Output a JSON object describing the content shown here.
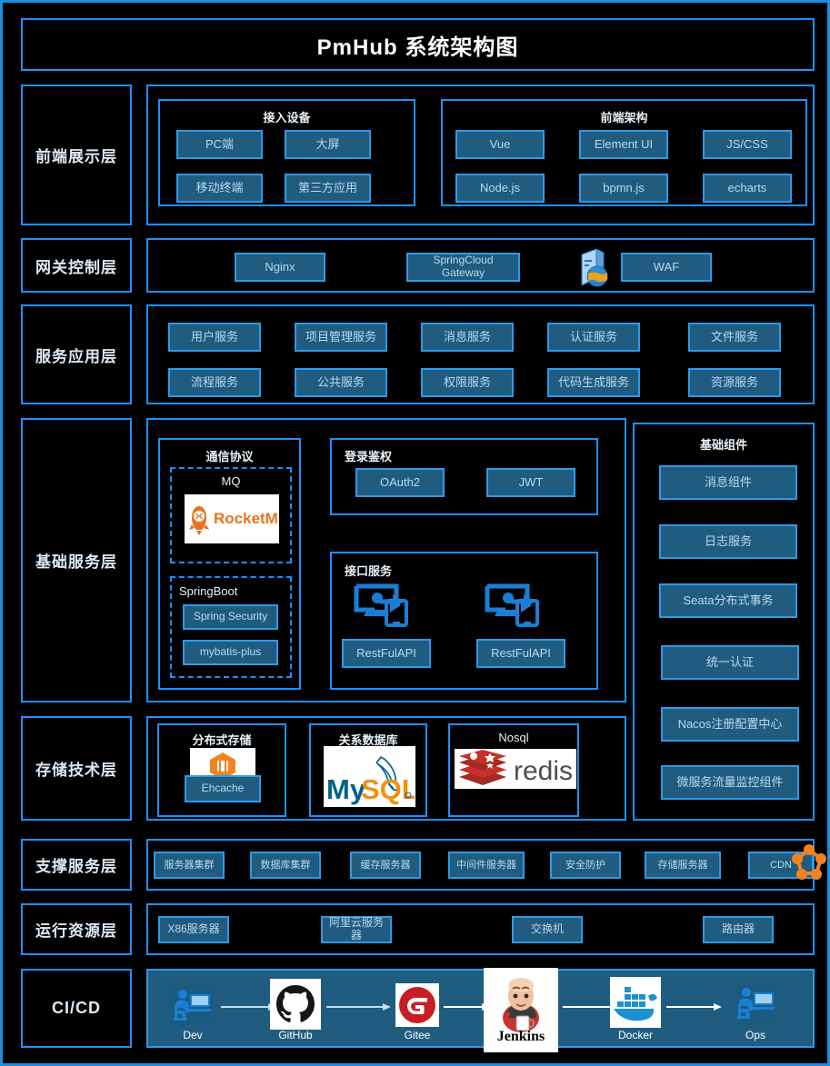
{
  "title": "PmHub 系统架构图",
  "layers": {
    "frontend": {
      "label": "前端展示层",
      "groups": [
        {
          "caption": "接入设备",
          "items": [
            "PC端",
            "大屏",
            "移动终端",
            "第三方应用"
          ]
        },
        {
          "caption": "前端架构",
          "items": [
            "Vue",
            "Element UI",
            "JS/CSS",
            "Node.js",
            "bpmn.js",
            "echarts"
          ]
        }
      ]
    },
    "gateway": {
      "label": "网关控制层",
      "items": [
        "Nginx",
        "SpringCloud Gateway",
        "WAF"
      ],
      "icon": "server-globe-icon"
    },
    "service": {
      "label": "服务应用层",
      "items": [
        "用户服务",
        "项目管理服务",
        "消息服务",
        "认证服务",
        "文件服务",
        "流程服务",
        "公共服务",
        "权限服务",
        "代码生成服务",
        "资源服务"
      ]
    },
    "base": {
      "label": "基础服务层",
      "comm": {
        "caption": "通信协议",
        "mq": {
          "caption": "MQ",
          "logo": "rocketmq-logo",
          "logo_text": "RocketMQ"
        },
        "springboot": {
          "caption": "SpringBoot",
          "items": [
            "Spring Security",
            "mybatis-plus"
          ]
        }
      },
      "auth": {
        "caption": "登录鉴权",
        "items": [
          "OAuth2",
          "JWT"
        ]
      },
      "api": {
        "caption": "接口服务",
        "items": [
          "RestFulAPI",
          "RestFulAPI"
        ],
        "icon": "screen-transfer-icon"
      }
    },
    "storage": {
      "label": "存储技术层",
      "groups": [
        {
          "caption": "分布式存储",
          "logo": "ehcache-logo",
          "chip": "Ehcache"
        },
        {
          "caption": "关系数据库",
          "logo": "mysql-logo"
        },
        {
          "caption": "Nosql",
          "logo": "redis-logo"
        }
      ]
    },
    "components": {
      "caption": "基础组件",
      "items": [
        "消息组件",
        "日志服务",
        "Seata分布式事务",
        "统一认证",
        "Nacos注册配置中心",
        "微服务流量监控组件"
      ]
    },
    "support": {
      "label": "支撑服务层",
      "items": [
        "服务器集群",
        "数据库集群",
        "缓存服务器",
        "中间件服务器",
        "安全防护",
        "存储服务器",
        "CDN"
      ],
      "icon": "cdn-molecule-icon"
    },
    "runtime": {
      "label": "运行资源层",
      "items": [
        "X86服务器",
        "阿里云服务器",
        "交换机",
        "路由器"
      ]
    },
    "cicd": {
      "label": "CI/CD",
      "steps": [
        {
          "label": "Dev",
          "icon": "developer-icon"
        },
        {
          "label": "GitHub",
          "icon": "github-logo"
        },
        {
          "label": "Gitee",
          "icon": "gitee-logo"
        },
        {
          "label": "Jenkins",
          "icon": "jenkins-logo"
        },
        {
          "label": "Docker",
          "icon": "docker-logo"
        },
        {
          "label": "Ops",
          "icon": "ops-icon"
        }
      ]
    }
  },
  "colors": {
    "background": "#000000",
    "border": "#1e90ff",
    "chip_fill": "#1f5c80",
    "chip_border": "#2e9ae8",
    "chip_text": "#bcd9ef",
    "label_text": "#dce9f5",
    "accent_orange": "#f28c28"
  }
}
